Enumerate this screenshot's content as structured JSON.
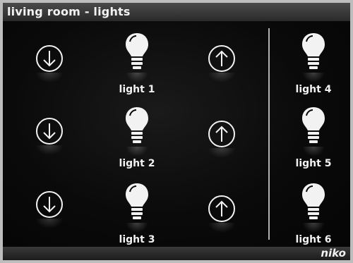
{
  "window": {
    "title": "living room - lights",
    "brand": "niko"
  },
  "lights": [
    {
      "label": "light 1",
      "icon": "lightbulb-icon"
    },
    {
      "label": "light 2",
      "icon": "lightbulb-icon"
    },
    {
      "label": "light 3",
      "icon": "lightbulb-icon"
    },
    {
      "label": "light 4",
      "icon": "lightbulb-icon"
    },
    {
      "label": "light 5",
      "icon": "lightbulb-icon"
    },
    {
      "label": "light 6",
      "icon": "lightbulb-icon"
    }
  ],
  "controls": {
    "down_icon": "arrow-down-circle-icon",
    "up_icon": "arrow-up-circle-icon"
  },
  "colors": {
    "background": "#050505",
    "foreground": "#f2f2f2",
    "titlebar": "#3a3a3a"
  }
}
